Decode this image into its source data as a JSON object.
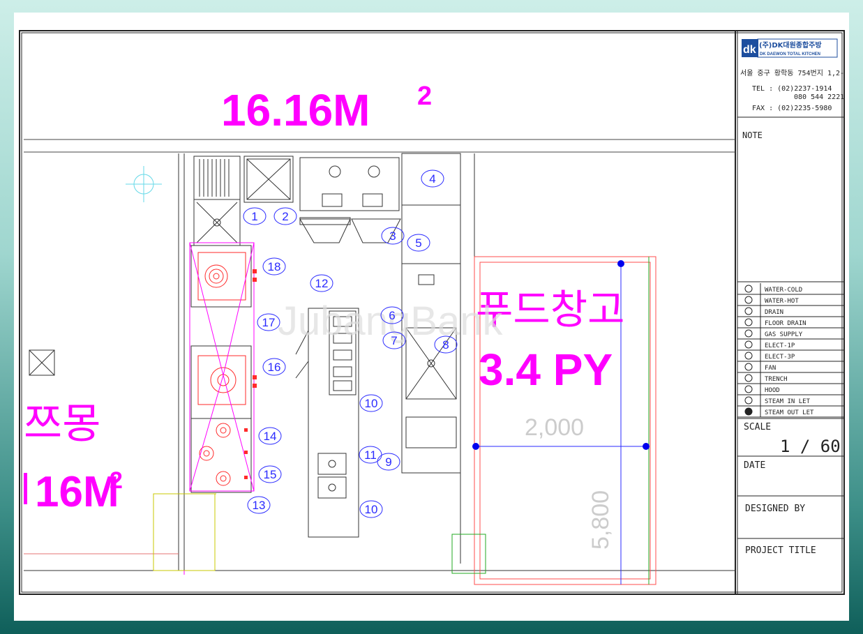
{
  "labels": {
    "area_top": "16.16M",
    "area_top_sup": "2",
    "area_left_name": "쯔몽",
    "area_left": "16M",
    "area_left_sup": "2",
    "storage_name": "푸드창고",
    "storage_area": "3.4 PY",
    "dim_width": "2,000",
    "dim_height": "5,800",
    "watermark": "JubangBank"
  },
  "equipment_numbers": [
    "1",
    "2",
    "3",
    "4",
    "5",
    "6",
    "7",
    "8",
    "9",
    "10",
    "10",
    "11",
    "12",
    "13",
    "14",
    "15",
    "16",
    "17",
    "18"
  ],
  "title_block": {
    "company_name": "(주)DK대원종합주방",
    "company_sub": "DK DAEWON TOTAL KITCHEN",
    "logo_text": "dk",
    "address": "서울 중구 황학동 754번지 1,2-",
    "tel1": "TEL : (02)2237-1914",
    "tel2": "080 544 2221",
    "fax": "FAX : (02)2235-5980",
    "note_label": "NOTE",
    "legend": [
      {
        "icon": "water-cold-icon",
        "label": "WATER-COLD"
      },
      {
        "icon": "water-hot-icon",
        "label": "WATER-HOT"
      },
      {
        "icon": "drain-icon",
        "label": "DRAIN"
      },
      {
        "icon": "floor-drain-icon",
        "label": "FLOOR DRAIN"
      },
      {
        "icon": "gas-supply-icon",
        "label": "GAS SUPPLY"
      },
      {
        "icon": "elect-1p-icon",
        "label": "ELECT-1P"
      },
      {
        "icon": "elect-3p-icon",
        "label": "ELECT-3P"
      },
      {
        "icon": "fan-icon",
        "label": "FAN"
      },
      {
        "icon": "trench-icon",
        "label": "TRENCH"
      },
      {
        "icon": "hood-icon",
        "label": "HOOD"
      },
      {
        "icon": "steam-in-let-icon",
        "label": "STEAM IN LET"
      },
      {
        "icon": "steam-out-let-icon",
        "label": "STEAM OUT LET"
      }
    ],
    "scale_label": "SCALE",
    "scale_value": "1 / 60",
    "date_label": "DATE",
    "designed_by_label": "DESIGNED BY",
    "project_title_label": "PROJECT TITLE"
  },
  "colors": {
    "magenta": "#ff00ff",
    "blue": "#2a2aff",
    "red": "#ff2a2a",
    "cyan": "#66d9e8",
    "line": "#333333",
    "green": "#22aa22",
    "dim_blue": "#0000ee"
  }
}
